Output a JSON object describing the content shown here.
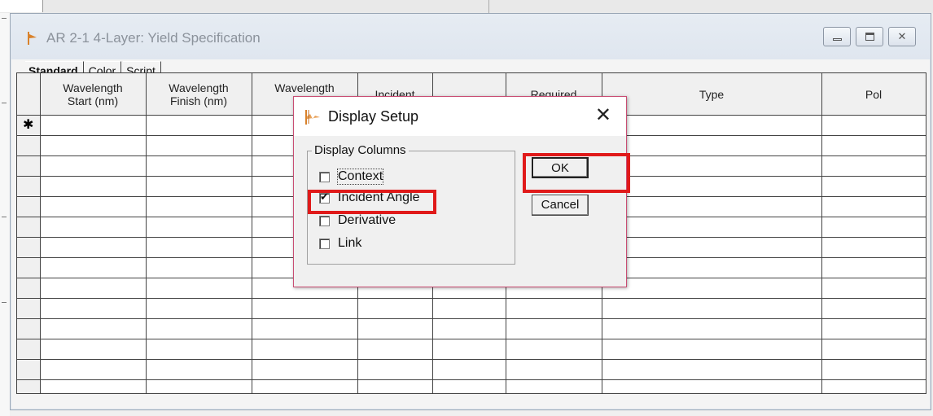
{
  "window": {
    "title": "AR 2-1 4-Layer: Yield Specification",
    "caption_close": "✕"
  },
  "tabs": [
    {
      "label": "Standard",
      "active": true
    },
    {
      "label": "Color",
      "active": false
    },
    {
      "label": "Script",
      "active": false
    }
  ],
  "table": {
    "columns": [
      {
        "line1": "Wavelength",
        "line2": "Start (nm)"
      },
      {
        "line1": "Wavelength",
        "line2": "Finish (nm)"
      },
      {
        "line1": "Wavelength",
        "line2": "S"
      },
      {
        "line1": "Incident",
        "line2": ""
      },
      {
        "line1": "",
        "line2": ""
      },
      {
        "line1": "Required",
        "line2": ""
      },
      {
        "line1": "Type",
        "line2": ""
      },
      {
        "line1": "Pol",
        "line2": ""
      }
    ],
    "new_row_marker": "✱"
  },
  "dialog": {
    "title": "Display Setup",
    "close_glyph": "✕",
    "group_label": "Display Columns",
    "checkboxes": [
      {
        "label": "Context",
        "checked": false,
        "focused": true
      },
      {
        "label": "Incident Angle",
        "checked": true,
        "focused": false
      },
      {
        "label": "Derivative",
        "checked": false,
        "focused": false
      },
      {
        "label": "Link",
        "checked": false,
        "focused": false
      }
    ],
    "ok_label": "OK",
    "cancel_label": "Cancel"
  },
  "colors": {
    "highlight": "#e01a1a",
    "dialog_border": "#c94d73",
    "title_text": "#8b929b"
  }
}
